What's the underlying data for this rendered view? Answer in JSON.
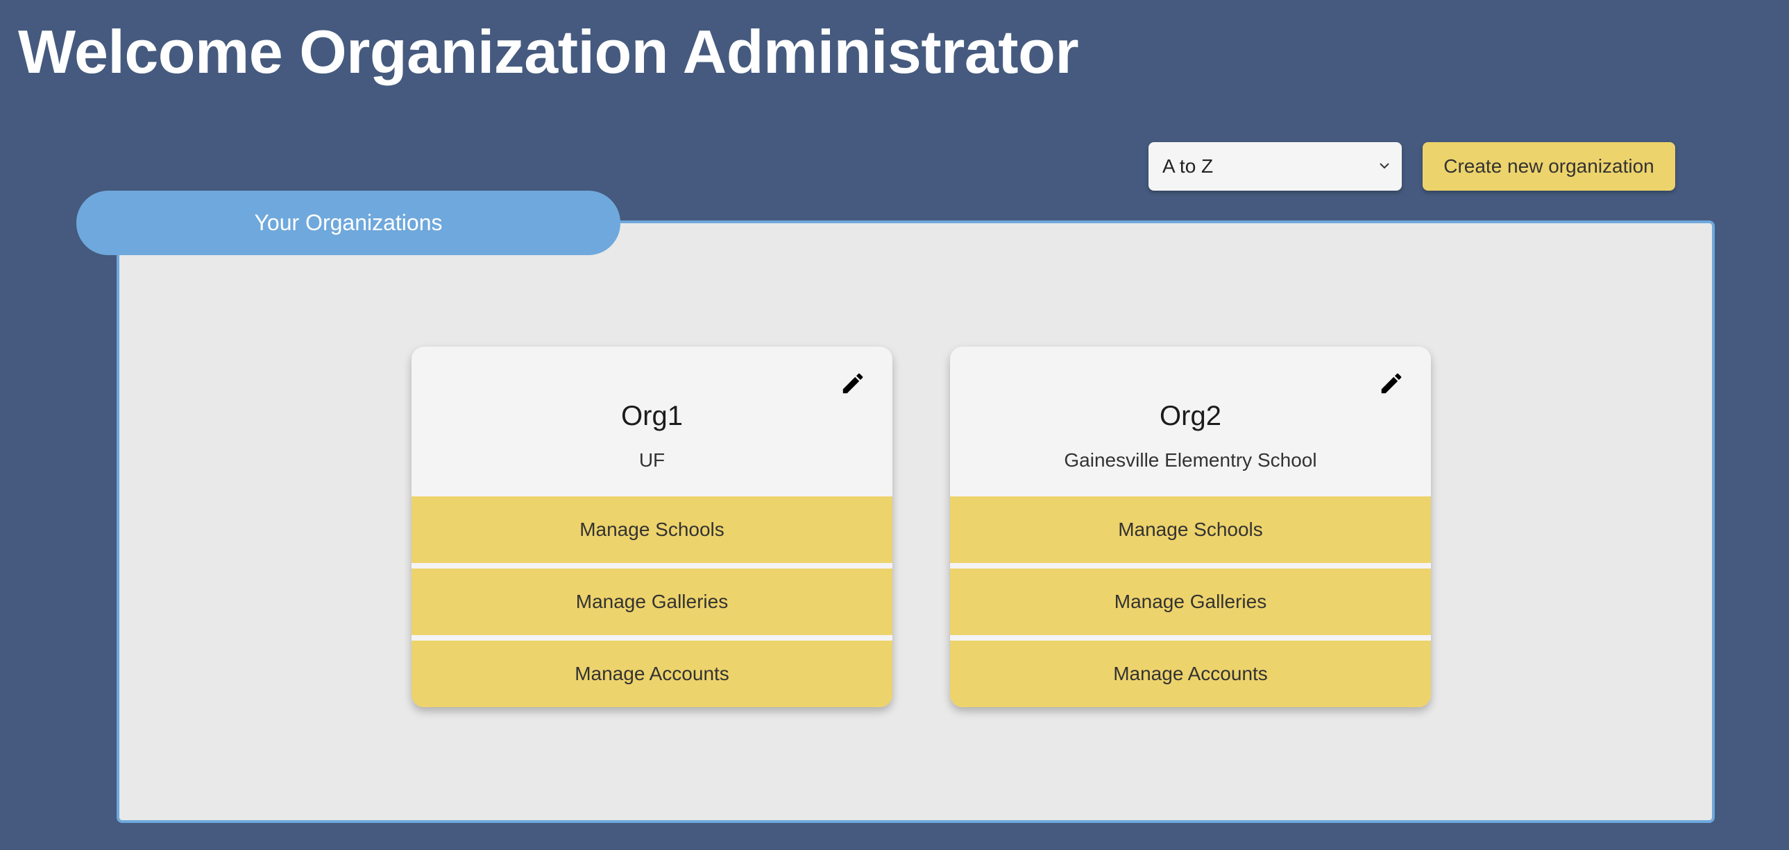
{
  "header": {
    "title": "Welcome Organization Administrator"
  },
  "toolbar": {
    "sort_value": "A to Z",
    "create_label": "Create new organization"
  },
  "panel": {
    "tab_label": "Your Organizations"
  },
  "organizations": [
    {
      "name": "Org1",
      "school": "UF",
      "actions": [
        "Manage Schools",
        "Manage Galleries",
        "Manage Accounts"
      ]
    },
    {
      "name": "Org2",
      "school": "Gainesville Elementry School",
      "actions": [
        "Manage Schools",
        "Manage Galleries",
        "Manage Accounts"
      ]
    }
  ],
  "colors": {
    "background": "#455a7e",
    "accent_yellow": "#edd36b",
    "accent_blue": "#6fa8dc",
    "panel": "#e9e9e9",
    "card": "#f4f4f4"
  },
  "icons": {
    "edit": "pencil-icon",
    "dropdown": "chevron-down-icon"
  }
}
